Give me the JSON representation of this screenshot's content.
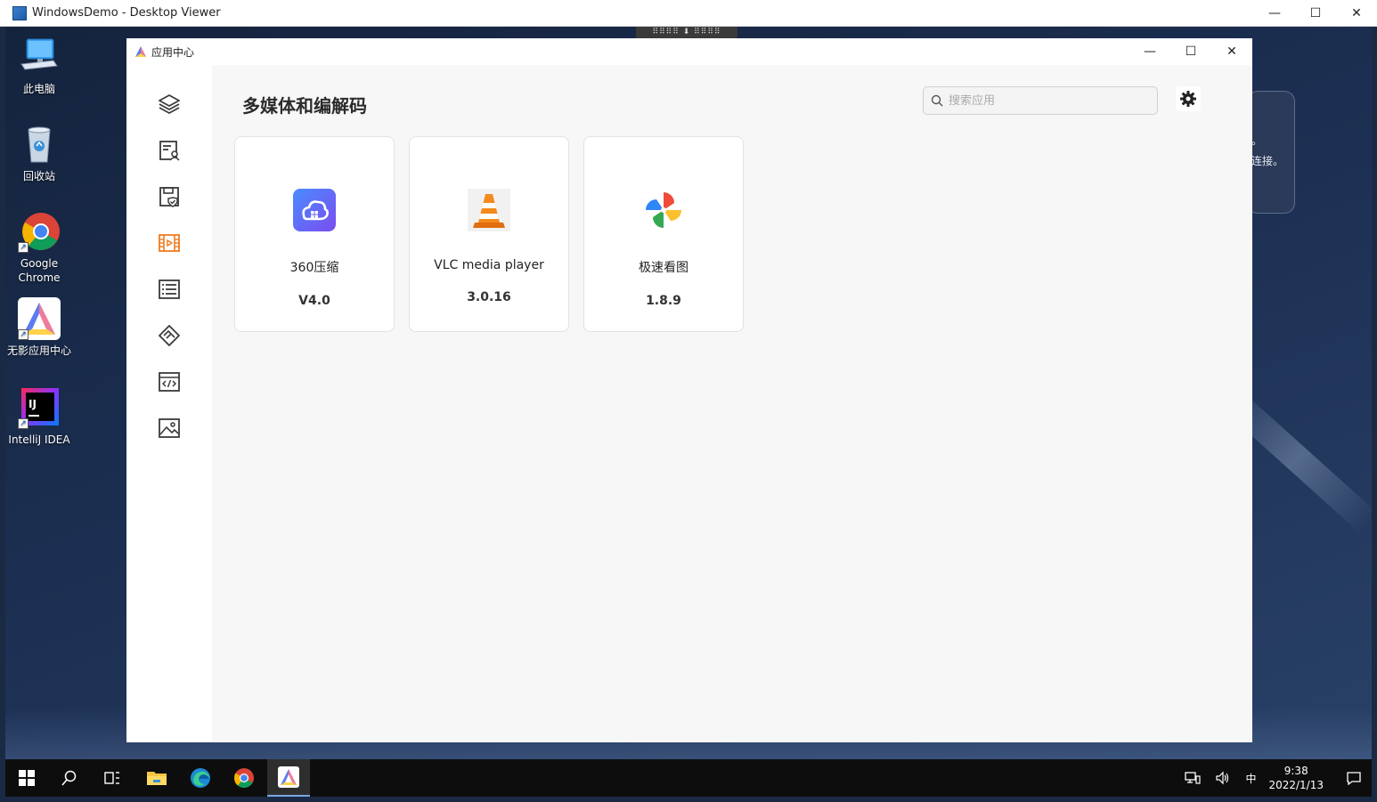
{
  "viewer": {
    "title": "WindowsDemo - Desktop Viewer",
    "minimize": "—",
    "maximize": "☐",
    "close": "✕"
  },
  "desktop": {
    "icons": [
      {
        "label": "此电脑",
        "icon": "computer-icon"
      },
      {
        "label": "回收站",
        "icon": "recycle-bin-icon"
      },
      {
        "label": "Google Chrome",
        "icon": "chrome-icon"
      },
      {
        "label": "无影应用中心",
        "icon": "app-center-icon"
      },
      {
        "label": "IntelliJ IDEA",
        "icon": "intellij-icon"
      }
    ],
    "background_panel_text": "连接。",
    "background_panel_dot": "。",
    "pull_tab": "⠿⠿⠿⠿ ⬇ ⠿⠿⠿⠿"
  },
  "app": {
    "title": "应用中心",
    "minimize": "—",
    "maximize": "☐",
    "close": "✕",
    "category_title": "多媒体和编解码",
    "search": {
      "placeholder": "搜索应用",
      "value": ""
    },
    "sidebar": {
      "items": [
        {
          "name": "all-apps",
          "icon": "layers-icon",
          "active": false
        },
        {
          "name": "remote-office",
          "icon": "computer-person-icon",
          "active": false
        },
        {
          "name": "security",
          "icon": "disk-shield-icon",
          "active": false
        },
        {
          "name": "multimedia",
          "icon": "film-icon",
          "active": true
        },
        {
          "name": "office",
          "icon": "list-doc-icon",
          "active": false
        },
        {
          "name": "collaboration",
          "icon": "handshake-icon",
          "active": false
        },
        {
          "name": "development",
          "icon": "code-window-icon",
          "active": false
        },
        {
          "name": "graphics",
          "icon": "image-icon",
          "active": false
        }
      ]
    },
    "apps": [
      {
        "name": "360压缩",
        "version": "V4.0",
        "icon": "360-zip-icon"
      },
      {
        "name": "VLC media player",
        "version": "3.0.16",
        "icon": "vlc-cone-icon"
      },
      {
        "name": "极速看图",
        "version": "1.8.9",
        "icon": "pinwheel-icon"
      }
    ]
  },
  "taskbar": {
    "items": [
      "start-icon",
      "search-icon",
      "task-view-icon",
      "file-explorer-icon",
      "edge-icon",
      "chrome-icon",
      "app-center-icon"
    ],
    "tray": {
      "ime": "中",
      "time": "9:38",
      "date": "2022/1/13"
    }
  },
  "colors": {
    "accent": "#f07b1f",
    "icon_gray": "#3a3a3a"
  }
}
